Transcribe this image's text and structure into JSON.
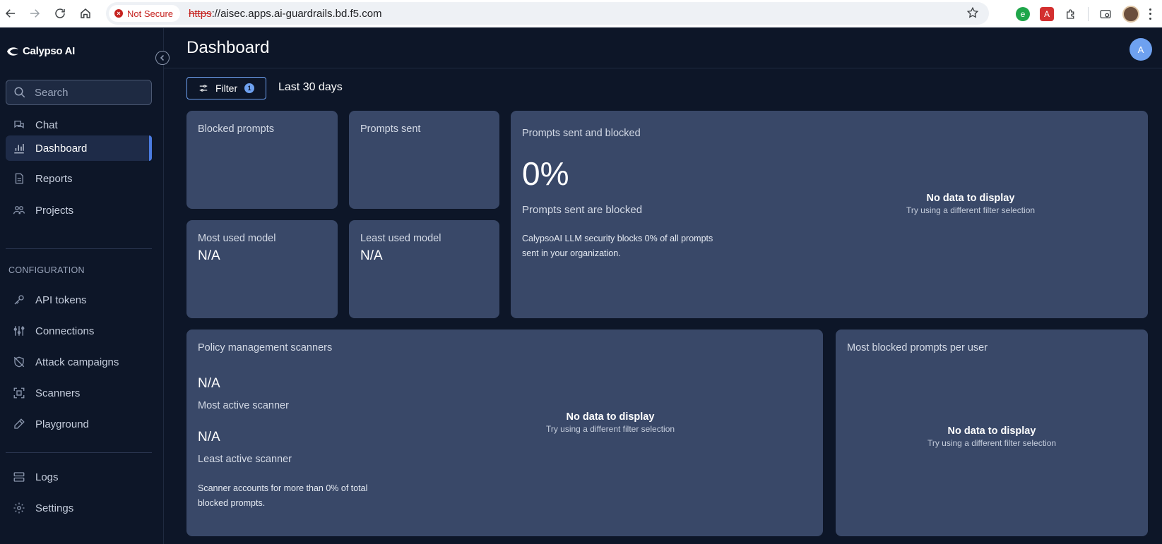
{
  "browser": {
    "security_label": "Not Secure",
    "url_scheme": "https",
    "url_rest": "://aisec.apps.ai-guardrails.bd.f5.com"
  },
  "sidebar": {
    "brand": "Calypso AI",
    "search_placeholder": "Search",
    "items": [
      {
        "label": "Chat",
        "icon": "chat-icon"
      },
      {
        "label": "Dashboard",
        "icon": "bar-chart-icon",
        "active": true
      },
      {
        "label": "Reports",
        "icon": "document-icon"
      },
      {
        "label": "Projects",
        "icon": "users-icon"
      }
    ],
    "config_label": "CONFIGURATION",
    "config_items": [
      {
        "label": "API tokens",
        "icon": "key-icon"
      },
      {
        "label": "Connections",
        "icon": "sliders-icon"
      },
      {
        "label": "Attack campaigns",
        "icon": "shield-off-icon"
      },
      {
        "label": "Scanners",
        "icon": "scan-icon"
      },
      {
        "label": "Playground",
        "icon": "pen-icon"
      }
    ],
    "bottom_items": [
      {
        "label": "Logs",
        "icon": "server-icon"
      },
      {
        "label": "Settings",
        "icon": "gear-icon"
      }
    ]
  },
  "header": {
    "title": "Dashboard",
    "avatar_initial": "A"
  },
  "filter": {
    "label": "Filter",
    "count": "1",
    "range": "Last 30 days"
  },
  "cards": {
    "blocked_prompts": {
      "title": "Blocked prompts"
    },
    "prompts_sent": {
      "title": "Prompts sent"
    },
    "most_used_model": {
      "title": "Most used model",
      "value": "N/A"
    },
    "least_used_model": {
      "title": "Least used model",
      "value": "N/A"
    },
    "sent_and_blocked": {
      "title": "Prompts sent and blocked",
      "percent": "0%",
      "subtitle": "Prompts sent are blocked",
      "desc_line1": "CalypsoAI LLM security blocks 0% of all prompts",
      "desc_line2": "sent in your organization.",
      "empty_title": "No data to display",
      "empty_hint": "Try using a different filter selection"
    },
    "policy_scanners": {
      "title": "Policy management scanners",
      "most_value": "N/A",
      "most_label": "Most active scanner",
      "least_value": "N/A",
      "least_label": "Least active scanner",
      "desc_line1": "Scanner accounts for more than 0% of total",
      "desc_line2": "blocked prompts.",
      "empty_title": "No data to display",
      "empty_hint": "Try using a different filter selection"
    },
    "blocked_per_user": {
      "title": "Most blocked prompts per user",
      "empty_title": "No data to display",
      "empty_hint": "Try using a different filter selection"
    }
  }
}
